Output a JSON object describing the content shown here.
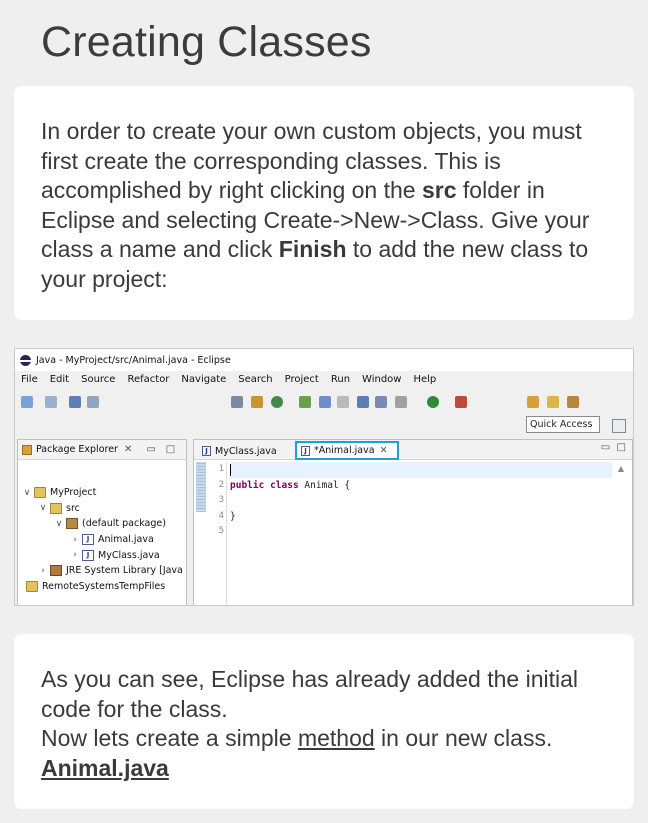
{
  "page": {
    "title": "Creating Classes"
  },
  "intro": {
    "part1": "In order to create your own custom objects, you must first create the corresponding classes. This is accomplished by right clicking on the ",
    "src_bold": "src",
    "part2": " folder in Eclipse and selecting Create->New->Class. Give your class a name and click ",
    "finish_bold": "Finish",
    "part3": " to add the new class to your project:"
  },
  "eclipse": {
    "window_title": "Java - MyProject/src/Animal.java - Eclipse",
    "menu": [
      "File",
      "Edit",
      "Source",
      "Refactor",
      "Navigate",
      "Search",
      "Project",
      "Run",
      "Window",
      "Help"
    ],
    "quick_access": "Quick Access",
    "package_explorer": {
      "tab_label": "Package Explorer",
      "tree": {
        "project": "MyProject",
        "src": "src",
        "default_package": "(default package)",
        "file1": "Animal.java",
        "file2": "MyClass.java",
        "jre": "JRE System Library [Java",
        "remote": "RemoteSystemsTempFiles"
      }
    },
    "editor": {
      "tab1": "MyClass.java",
      "tab2": "*Animal.java",
      "line_numbers": [
        "1",
        "2",
        "3",
        "4",
        "5"
      ],
      "code": {
        "kw1": "public",
        "kw2": "class",
        "class_name": " Animal {",
        "closing": "}"
      }
    }
  },
  "outro": {
    "line1": "As you can see, Eclipse has already added the initial code for the class.",
    "line2_pre": "Now lets create a simple ",
    "method_link": "method",
    "line2_post": " in our new class.",
    "file_link": "Animal.java"
  }
}
